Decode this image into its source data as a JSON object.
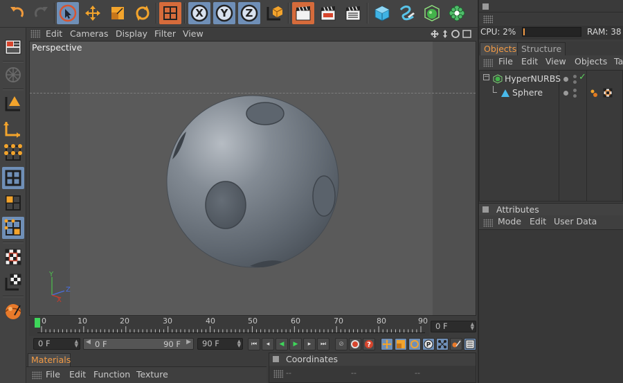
{
  "viewport": {
    "menu": [
      "Edit",
      "Cameras",
      "Display",
      "Filter",
      "View"
    ],
    "camera_label": "Perspective",
    "axis_labels": {
      "x": "X",
      "y": "Y",
      "z": "Z"
    }
  },
  "timeline": {
    "ticks": [
      "0",
      "10",
      "20",
      "30",
      "40",
      "50",
      "60",
      "70",
      "80",
      "90"
    ],
    "current_frame_right": "0 F",
    "start_field": "0 F",
    "range_start": "0 F",
    "range_end": "90 F",
    "end_field": "90 F"
  },
  "materials": {
    "tab_label": "Materials",
    "menu": [
      "File",
      "Edit",
      "Function",
      "Texture"
    ]
  },
  "coordinates": {
    "title": "Coordinates",
    "values": [
      "--",
      "--",
      "--"
    ]
  },
  "status": {
    "cpu": "CPU: 2%",
    "ram": "RAM: 38"
  },
  "objects_panel": {
    "tabs": [
      "Objects",
      "Structure"
    ],
    "menu": [
      "File",
      "Edit",
      "View",
      "Objects",
      "Ta"
    ],
    "items": [
      {
        "name": "HyperNURBS",
        "check": "✓"
      },
      {
        "name": "Sphere"
      }
    ]
  },
  "attributes": {
    "title": "Attributes",
    "menu": [
      "Mode",
      "Edit",
      "User Data"
    ]
  },
  "colors": {
    "accent_orange": "#f39b45",
    "highlight_blue": "#6f8fb7",
    "viewport_bg": "#5a5a5a"
  }
}
